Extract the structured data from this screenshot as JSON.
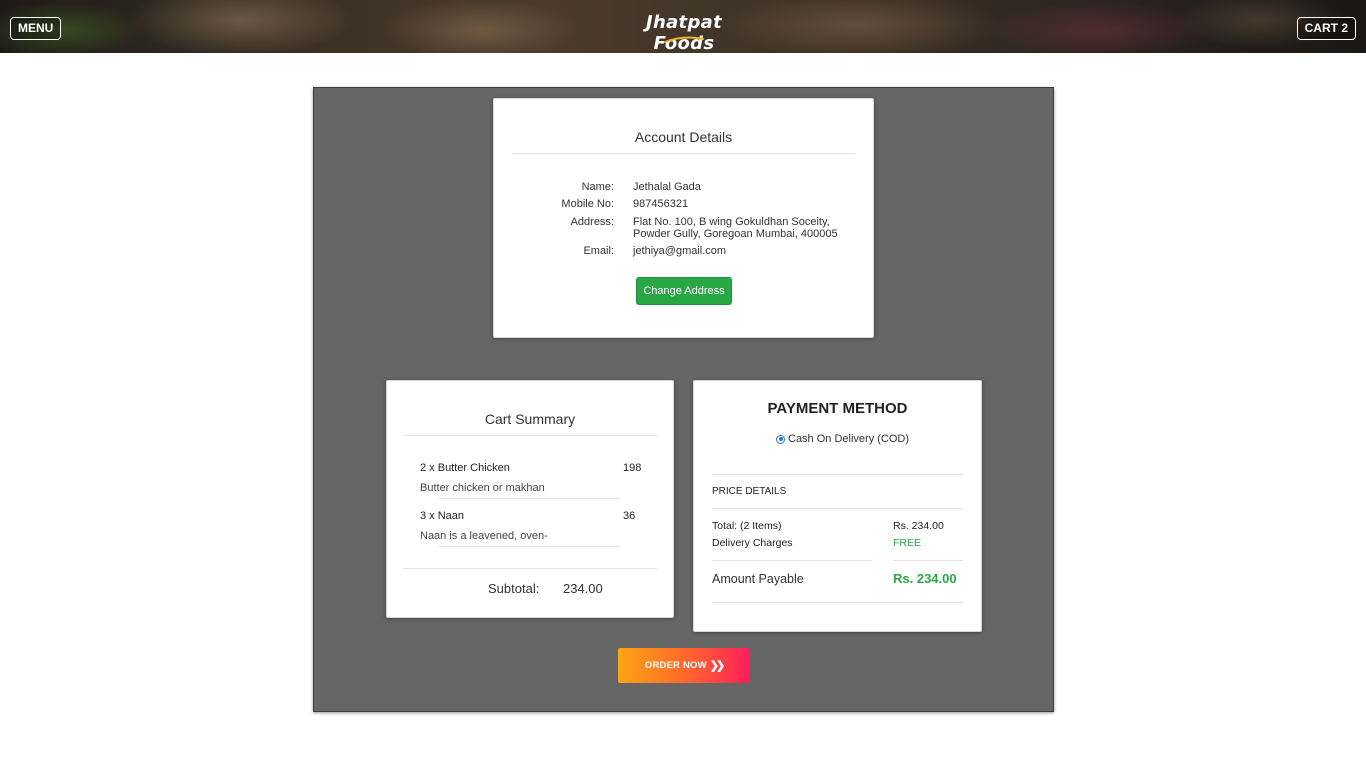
{
  "header": {
    "menu_label": "MENU",
    "brand": "Jhatpat Foods",
    "cart_label": "CART",
    "cart_count": "2"
  },
  "account": {
    "title": "Account Details",
    "fields": [
      {
        "label": "Name:",
        "value": "Jethalal Gada"
      },
      {
        "label": "Mobile No:",
        "value": "987456321"
      },
      {
        "label": "Address:",
        "value": "Flat No. 100, B wing Gokuldhan Soceity, Powder Gully, Goregoan Mumbai, 400005"
      },
      {
        "label": "Email:",
        "value": "jethiya@gmail.com"
      }
    ],
    "change_address_label": "Change Address"
  },
  "cart_summary": {
    "title": "Cart Summary",
    "items": [
      {
        "name": "2 x Butter Chicken",
        "price": "198",
        "desc": "Butter chicken or makhan"
      },
      {
        "name": "3 x Naan",
        "price": "36",
        "desc": "Naan is a leavened, oven-"
      }
    ],
    "subtotal_label": "Subtotal:",
    "subtotal_value": "234.00"
  },
  "payment": {
    "title": "PAYMENT METHOD",
    "option_label": "Cash On Delivery (COD)",
    "option_selected": true,
    "price_details_heading": "PRICE DETAILS",
    "total_label": "Total: (2 Items)",
    "total_value": "Rs. 234.00",
    "delivery_label": "Delivery Charges",
    "delivery_value": "FREE",
    "amount_label": "Amount Payable",
    "amount_value": "Rs. 234.00"
  },
  "order_button": {
    "label": "ORDER NOW",
    "icon": "double-chevron-right-icon"
  },
  "colors": {
    "panel_bg": "#666666",
    "success_green": "#28a745",
    "order_gradient_start": "#ffa413",
    "order_gradient_end": "#ff1f5a"
  }
}
